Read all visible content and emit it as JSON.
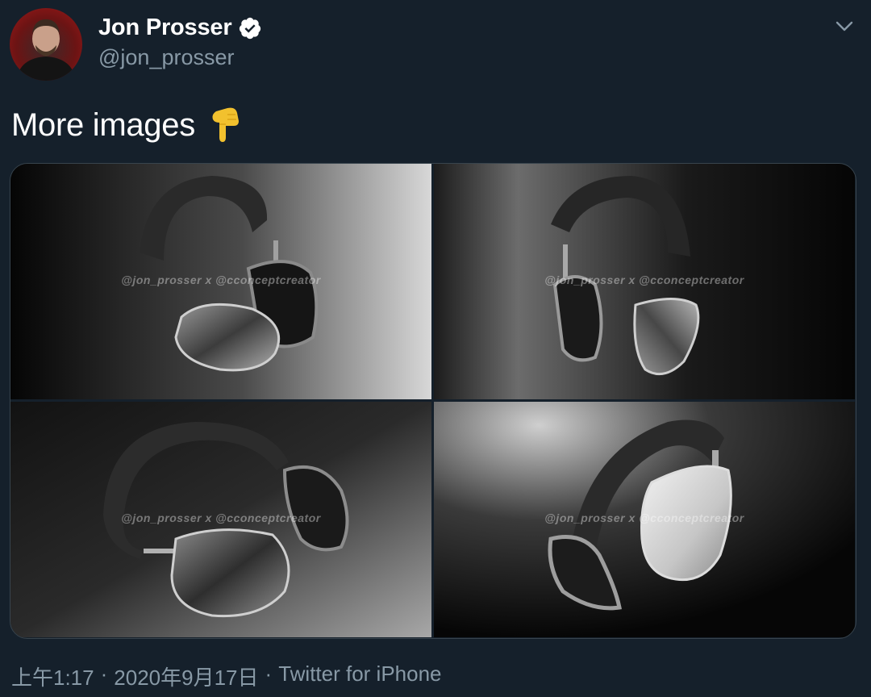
{
  "author": {
    "display_name": "Jon Prosser",
    "handle": "@jon_prosser",
    "verified_icon": "verified-badge-icon",
    "avatar_icon": "avatar"
  },
  "tweet": {
    "text": "More images",
    "emoji": "👇",
    "emoji_icon": "backhand-index-pointing-down-icon"
  },
  "media": {
    "photos": [
      {
        "watermark": "@jon_prosser x @cconceptcreator"
      },
      {
        "watermark": "@jon_prosser x @cconceptcreator"
      },
      {
        "watermark": "@jon_prosser x @cconceptcreator"
      },
      {
        "watermark": "@jon_prosser x @cconceptcreator"
      }
    ]
  },
  "meta": {
    "time": "上午1:17",
    "sep1": "·",
    "date": "2020年9月17日",
    "sep2": "·",
    "source": "Twitter for iPhone"
  },
  "colors": {
    "background": "#15202b",
    "secondary_text": "#8899a6",
    "border": "#38444d",
    "verified_badge": "#ffffff"
  }
}
